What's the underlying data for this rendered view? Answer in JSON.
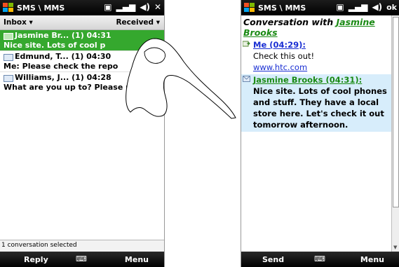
{
  "left_screen": {
    "title": "SMS \\ MMS",
    "subhead": {
      "folder": "Inbox ▾",
      "sort": "Received ▾"
    },
    "messages": [
      {
        "line1": "Jasmine Br... (1)  04:31",
        "line2": "Nice site. Lots of cool p",
        "selected": true
      },
      {
        "line1": "Edmund, T... (1)  04:30",
        "line2": "Me: Please check the repo",
        "selected": false
      },
      {
        "line1": "Williams, J... (1)  04:28",
        "line2": "What are you up to? Please r...",
        "selected": false
      }
    ],
    "status_text": "1 conversation selected",
    "softkeys": {
      "left": "Reply",
      "right": "Menu"
    }
  },
  "right_screen": {
    "title": "SMS \\ MMS",
    "ok_label": "ok",
    "conversation_prefix": "Conversation with ",
    "contact_name": "Jasmine Brooks",
    "me_header": "Me (04:29):",
    "me_text": "Check this out!",
    "me_link": "www.htc.com",
    "them_header": "Jasmine Brooks (04:31):",
    "them_text": "Nice site. Lots of cool phones and stuff. They have a local store here. Let's check it out tomorrow afternoon.",
    "softkeys": {
      "left": "Send",
      "right": "Menu"
    }
  },
  "colors": {
    "selection_green": "#35a82e",
    "link_blue": "#1a2fd3",
    "contact_green": "#1a8a14",
    "bubble_blue": "#d7edfb"
  }
}
